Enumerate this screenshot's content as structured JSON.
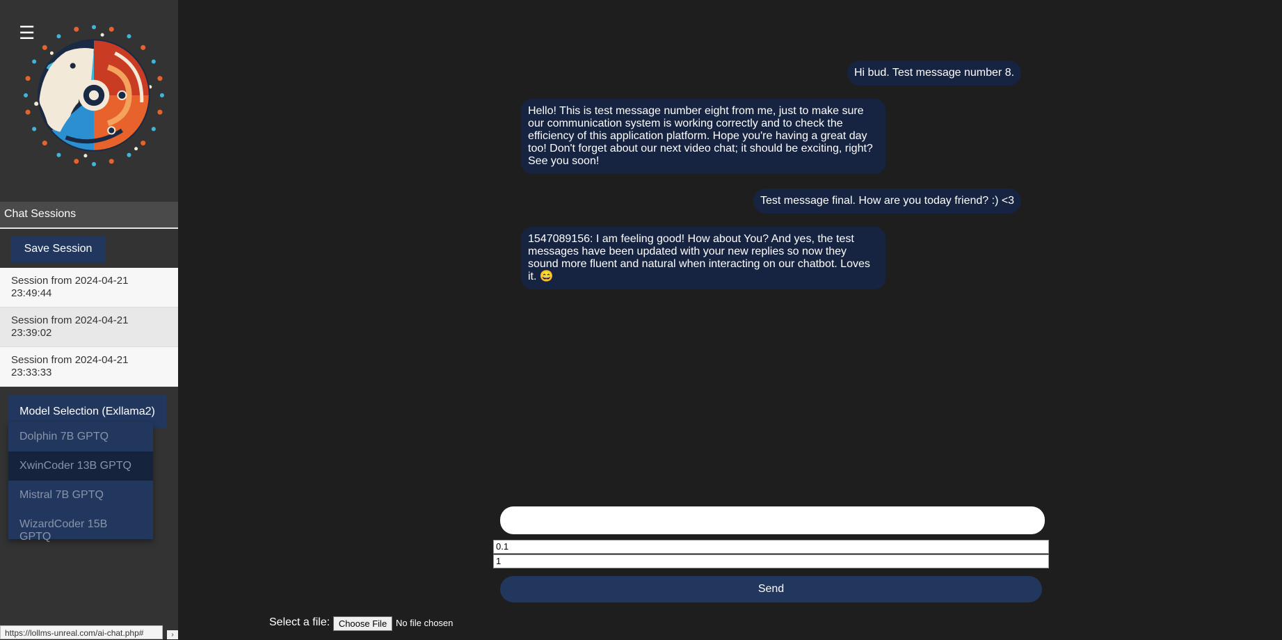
{
  "sidebar": {
    "menu_icon": "hamburger-icon",
    "menu_glyph": "☰",
    "logo": "ai-brain-logo",
    "sessions_header": "Chat Sessions",
    "save_button": "Save Session",
    "sessions": [
      {
        "label": "Session from 2024-04-21 23:49:44"
      },
      {
        "label": "Session from 2024-04-21 23:39:02"
      },
      {
        "label": "Session from 2024-04-21 23:33:33"
      }
    ],
    "model_button": "Model Selection (Exllama2)",
    "models": [
      {
        "label": "Dolphin 7B GPTQ"
      },
      {
        "label": "XwinCoder 13B GPTQ"
      },
      {
        "label": "Mistral 7B GPTQ"
      },
      {
        "label": "WizardCoder 15B GPTQ"
      }
    ]
  },
  "messages": [
    {
      "role": "user",
      "text": "Hi bud. Test message number 8."
    },
    {
      "role": "bot",
      "text": "Hello! This is test message number eight from me, just to make sure our communication system is working correctly and to check the efficiency of this application platform. Hope you're having a great day too! Don't forget about our next video chat; it should be exciting, right? See you soon!"
    },
    {
      "role": "user",
      "text": "Test message final. How are you today friend? :) <3"
    },
    {
      "role": "bot",
      "text": "1547089156: I am feeling good! How about You? And yes, the test messages have been updated with your new replies so now they sound more fluent and natural when interacting on our chatbot. Loves it. 😄"
    }
  ],
  "input": {
    "message_value": "",
    "temperature_value": "0.1",
    "second_value": "1"
  },
  "send_button": "Send",
  "file": {
    "label": "Select a file:",
    "choose_button": "Choose File",
    "status": "No file chosen"
  },
  "status_bar": {
    "url": "https://lollms-unreal.com/ai-chat.php#",
    "arrow": "›"
  },
  "colors": {
    "background": "#1e1e1e",
    "sidebar": "#333333",
    "accent": "#22375e",
    "bubble": "#172441"
  }
}
